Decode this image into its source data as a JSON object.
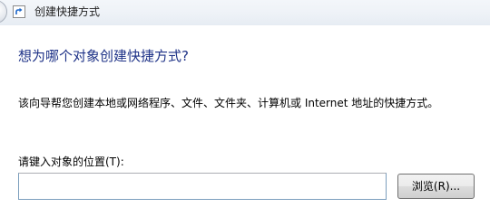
{
  "window": {
    "title": "创建快捷方式",
    "icon": "shortcut-arrow-icon"
  },
  "navigation": {
    "back_icon": "back-arrow-icon"
  },
  "main": {
    "heading": "想为哪个对象创建快捷方式?",
    "description": "该向导帮您创建本地或网络程序、文件、文件夹、计算机或 Internet 地址的快捷方式。",
    "location_label": "请键入对象的位置(T):",
    "location_value": "",
    "browse_label": "浏览(R)..."
  },
  "colors": {
    "heading": "#1e3287",
    "title_bar": "#eef2f7",
    "input_border": "#7b9ebd"
  }
}
